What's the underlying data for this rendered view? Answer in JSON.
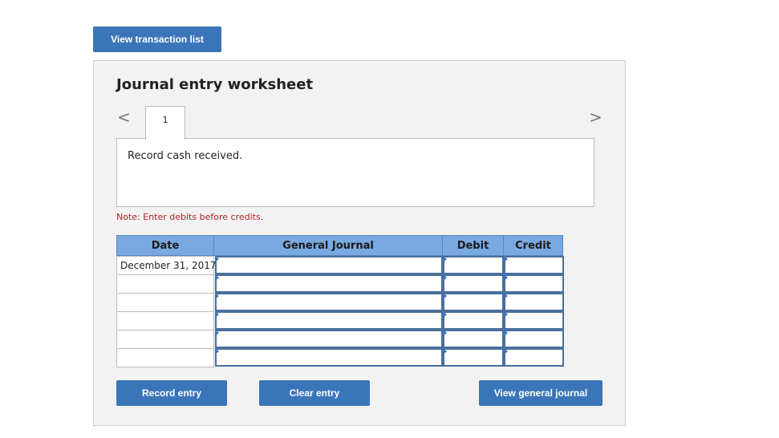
{
  "top_button": {
    "label": "View transaction list"
  },
  "worksheet": {
    "title": "Journal entry worksheet",
    "tabs": [
      {
        "label": "1"
      }
    ],
    "description": "Record cash received.",
    "note": "Note: Enter debits before credits.",
    "nav": {
      "prev": "<",
      "next": ">"
    }
  },
  "table": {
    "headers": {
      "date": "Date",
      "general_journal": "General Journal",
      "debit": "Debit",
      "credit": "Credit"
    },
    "rows": [
      {
        "date": "December 31, 2017",
        "account": "",
        "debit": "",
        "credit": ""
      },
      {
        "date": "",
        "account": "",
        "debit": "",
        "credit": ""
      },
      {
        "date": "",
        "account": "",
        "debit": "",
        "credit": ""
      },
      {
        "date": "",
        "account": "",
        "debit": "",
        "credit": ""
      },
      {
        "date": "",
        "account": "",
        "debit": "",
        "credit": ""
      },
      {
        "date": "",
        "account": "",
        "debit": "",
        "credit": ""
      }
    ]
  },
  "actions": {
    "record_entry": "Record entry",
    "clear_entry": "Clear entry",
    "view_general_journal": "View general journal"
  },
  "colors": {
    "button_blue": "#3a75b9",
    "header_blue": "#79a9e1",
    "note_red": "#b22222",
    "panel_gray": "#f2f2f2"
  }
}
